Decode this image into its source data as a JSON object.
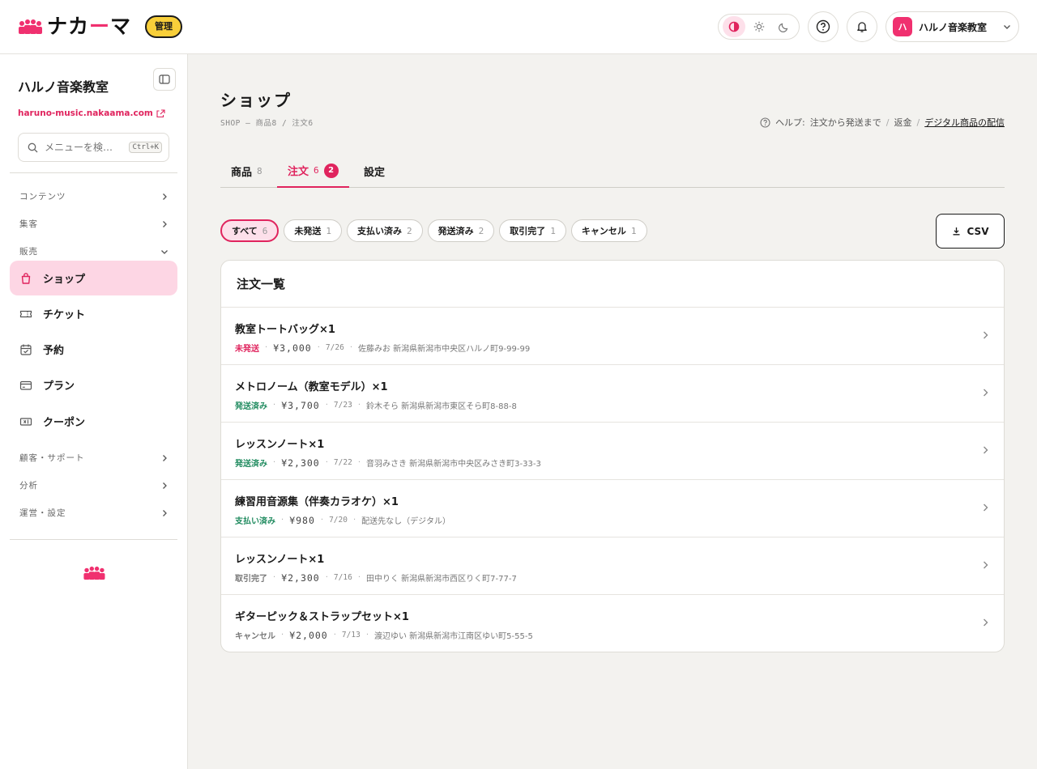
{
  "header": {
    "logo_text_1": "ナカ",
    "logo_text_accent": "ー",
    "logo_text_2": "マ",
    "admin_badge": "管理",
    "account_avatar": "ハ",
    "account_name": "ハルノ音楽教室"
  },
  "sidebar": {
    "school_name": "ハルノ音楽教室",
    "site_url": "haruno-music.nakaama.com",
    "search_placeholder": "メニューを検…",
    "search_shortcut": "Ctrl+K",
    "sections": {
      "contents": "コンテンツ",
      "marketing": "集客",
      "sales": "販売",
      "customer": "顧客・サポート",
      "analytics": "分析",
      "operations": "運営・設定"
    },
    "items": {
      "shop": "ショップ",
      "ticket": "チケット",
      "booking": "予約",
      "plan": "プラン",
      "coupon": "クーポン"
    }
  },
  "main": {
    "title": "ショップ",
    "breadcrumb": "SHOP — 商品8 / 注文6",
    "help_prefix": "ヘルプ:",
    "help_links": [
      "注文から発送まで",
      "返金",
      "デジタル商品の配信"
    ],
    "help_sep": "/",
    "tabs": [
      {
        "label": "商品",
        "count": "8"
      },
      {
        "label": "注文",
        "count": "6",
        "badge": "2"
      },
      {
        "label": "設定"
      }
    ],
    "filters": [
      {
        "label": "すべて",
        "count": "6"
      },
      {
        "label": "未発送",
        "count": "1"
      },
      {
        "label": "支払い済み",
        "count": "2"
      },
      {
        "label": "発送済み",
        "count": "2"
      },
      {
        "label": "取引完了",
        "count": "1"
      },
      {
        "label": "キャンセル",
        "count": "1"
      }
    ],
    "csv_label": "CSV",
    "orders_title": "注文一覧",
    "orders": [
      {
        "name": "教室トートバッグ×1",
        "status": "未発送",
        "status_color": "#e0245e",
        "price": "¥3,000",
        "date": "7/26",
        "customer": "佐藤みお 新潟県新潟市中央区ハルノ町9-99-99"
      },
      {
        "name": "メトロノーム（教室モデル）×1",
        "status": "発送済み",
        "status_color": "#1e8a5e",
        "price": "¥3,700",
        "date": "7/23",
        "customer": "鈴木そら 新潟県新潟市東区そら町8-88-8"
      },
      {
        "name": "レッスンノート×1",
        "status": "発送済み",
        "status_color": "#1e8a5e",
        "price": "¥2,300",
        "date": "7/22",
        "customer": "音羽みさき 新潟県新潟市中央区みさき町3-33-3"
      },
      {
        "name": "練習用音源集（伴奏カラオケ）×1",
        "status": "支払い済み",
        "status_color": "#1e8a5e",
        "price": "¥980",
        "date": "7/20",
        "customer": "配送先なし（デジタル）"
      },
      {
        "name": "レッスンノート×1",
        "status": "取引完了",
        "status_color": "#777777",
        "price": "¥2,300",
        "date": "7/16",
        "customer": "田中りく 新潟県新潟市西区りく町7-77-7"
      },
      {
        "name": "ギターピック＆ストラップセット×1",
        "status": "キャンセル",
        "status_color": "#777777",
        "price": "¥2,000",
        "date": "7/13",
        "customer": "渡辺ゆい 新潟県新潟市江南区ゆい町5-55-5"
      }
    ]
  },
  "colors": {
    "accent": "#e0245e",
    "accent_light": "#fdd6e4",
    "badge_yellow": "#f8cf3a"
  }
}
